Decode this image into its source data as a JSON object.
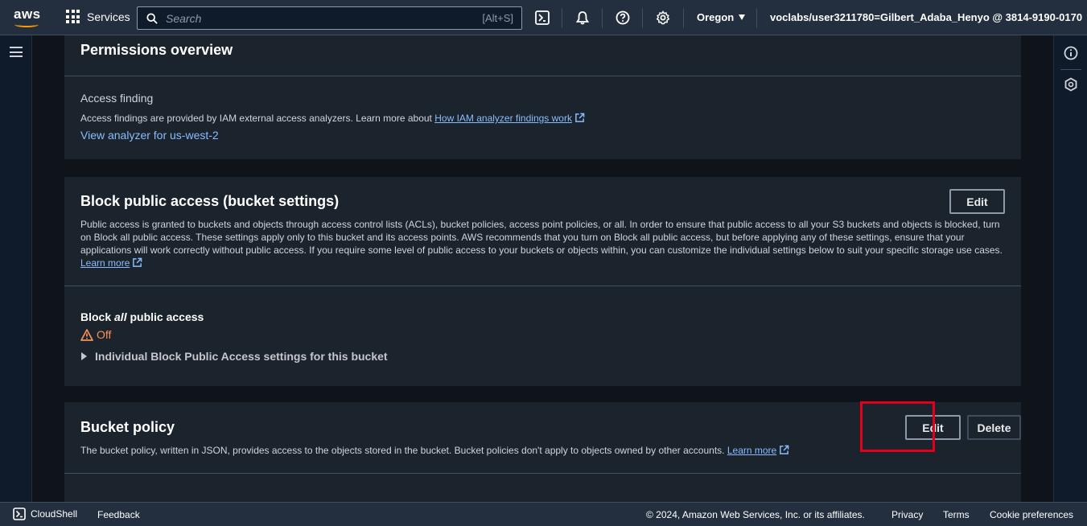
{
  "topnav": {
    "logo_text": "aws",
    "services_label": "Services",
    "search_placeholder": "Search",
    "search_shortcut": "[Alt+S]",
    "region_label": "Oregon",
    "account_label": "voclabs/user3211780=Gilbert_Adaba_Henyo @ 3814-9190-0170",
    "icons": [
      "cloudshell-icon",
      "bell-icon",
      "help-icon",
      "settings-icon"
    ]
  },
  "permissions_overview": {
    "title": "Permissions overview",
    "access_finding_label": "Access finding",
    "access_finding_text": "Access findings are provided by IAM external access analyzers. Learn more about",
    "access_finding_link": "How IAM analyzer findings work",
    "view_analyzer_link": "View analyzer for us-west-2"
  },
  "block_public_access": {
    "title": "Block public access (bucket settings)",
    "edit_label": "Edit",
    "description": "Public access is granted to buckets and objects through access control lists (ACLs), bucket policies, access point policies, or all. In order to ensure that public access to all your S3 buckets and objects is blocked, turn on Block all public access. These settings apply only to this bucket and its access points. AWS recommends that you turn on Block all public access, but before applying any of these settings, ensure that your applications will work correctly without public access. If you require some level of public access to your buckets or objects within, you can customize the individual settings below to suit your specific storage use cases.",
    "learn_more": "Learn more",
    "block_all_prefix": "Block ",
    "block_all_emph": "all",
    "block_all_suffix": " public access",
    "status_value": "Off",
    "status_color": "#f89256",
    "expander_label": "Individual Block Public Access settings for this bucket"
  },
  "bucket_policy": {
    "title": "Bucket policy",
    "edit_label": "Edit",
    "delete_label": "Delete",
    "description": "The bucket policy, written in JSON, provides access to the objects stored in the bucket. Bucket policies don't apply to objects owned by other accounts.",
    "learn_more": "Learn more"
  },
  "footer": {
    "cloudshell": "CloudShell",
    "feedback": "Feedback",
    "copyright": "© 2024, Amazon Web Services, Inc. or its affiliates.",
    "privacy": "Privacy",
    "terms": "Terms",
    "cookie": "Cookie preferences"
  },
  "colors": {
    "link": "#89bdff",
    "highlight": "#e3001b",
    "brand_orange": "#ff9900"
  }
}
